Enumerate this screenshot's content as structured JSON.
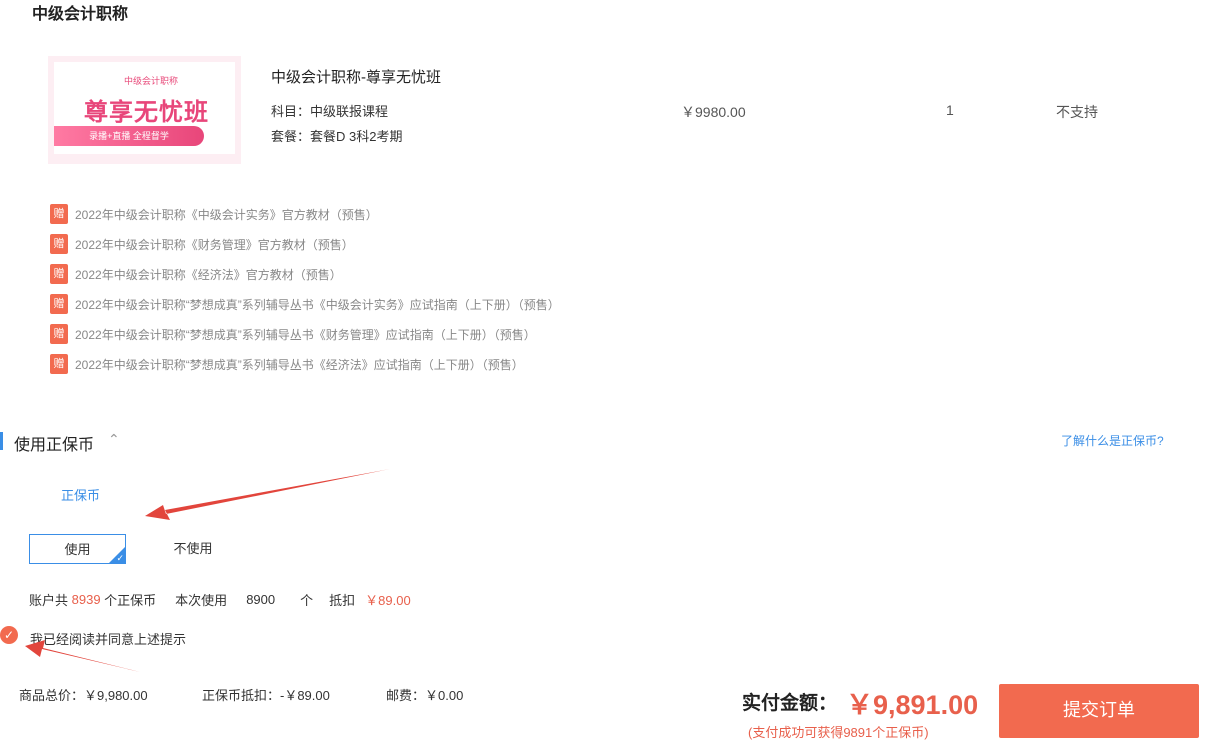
{
  "page_title": "中级会计职称",
  "product": {
    "thumb_small": "中级会计职称",
    "thumb_main": "尊享无忧班",
    "thumb_banner": "录播+直播 全程督学",
    "name": "中级会计职称-尊享无忧班",
    "subject": "科目：中级联报课程",
    "plan": "套餐：套餐D 3科2考期",
    "price": "￥9980.00",
    "qty": "1",
    "support": "不支持"
  },
  "gift_tag": "赠",
  "gifts": [
    "2022年中级会计职称《中级会计实务》官方教材（预售）",
    "2022年中级会计职称《财务管理》官方教材（预售）",
    "2022年中级会计职称《经济法》官方教材（预售）",
    "2022年中级会计职称“梦想成真”系列辅导丛书《中级会计实务》应试指南（上下册）（预售）",
    "2022年中级会计职称“梦想成真”系列辅导丛书《财务管理》应试指南（上下册）（预售）",
    "2022年中级会计职称“梦想成真”系列辅导丛书《经济法》应试指南（上下册）（预售）"
  ],
  "coin": {
    "section_title": "使用正保币",
    "learn_link": "了解什么是正保币?",
    "label": "正保币",
    "use": "使用",
    "no_use": "不使用",
    "acct_prefix": "账户共 ",
    "acct_total": "8939",
    "acct_unit": " 个正保币",
    "this_use": "本次使用",
    "use_amount": "8900",
    "unit": "个",
    "deduct_label": "抵扣",
    "deduct_amount": "￥89.00"
  },
  "agree_text": "我已经阅读并同意上述提示",
  "summary": {
    "goods": "商品总价：￥9,980.00",
    "coin": "正保币抵扣：-￥89.00",
    "postage": "邮费：￥0.00"
  },
  "pay": {
    "label": "实付金额：",
    "amount": "￥9,891.00",
    "note": "(支付成功可获得9891个正保币)",
    "submit": "提交订单"
  },
  "colors": {
    "accent": "#3a8ee6",
    "orange": "#f26a4f",
    "red_text": "#e8604c",
    "annotation_arrow": "#e2453c"
  }
}
